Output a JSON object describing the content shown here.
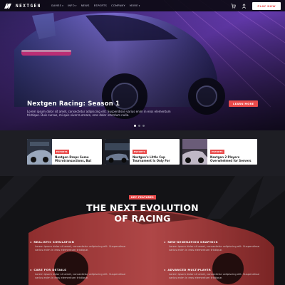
{
  "nav": {
    "logo_icon": "nextgen-logo-icon",
    "wordmark": "NEXTGEN",
    "items": [
      {
        "label": "GAMES",
        "dropdown": true
      },
      {
        "label": "INFO",
        "dropdown": true
      },
      {
        "label": "NEWS",
        "dropdown": false
      },
      {
        "label": "ESPORTS",
        "dropdown": false
      },
      {
        "label": "COMPANY",
        "dropdown": false
      },
      {
        "label": "MORE",
        "dropdown": true
      }
    ],
    "cart_icon": "cart-icon",
    "user_icon": "user-icon",
    "play_label": "PLAY NOW"
  },
  "hero": {
    "title": "Nextgen Racing: Season 1",
    "description": "Lorem ipsum dolor sit amet, consectetur adipiscing elit. Suspendisse varius enim in eros elementum tristique. Duis cursus, mi quis viverra ornare, eros dolor interdum nulla.",
    "cta_label": "LEARN MORE",
    "slides": 3,
    "active_slide": 1
  },
  "news": {
    "cards": [
      {
        "badge": "ESPORTS",
        "title": "Nextgen Drops Some Microtransactions, But"
      },
      {
        "badge": "ESPORTS",
        "title": "Nextgen's Little Cup Tournament Is Only For"
      },
      {
        "badge": "ESPORTS",
        "title": "Nextgen 2 Players Overwhelmed for Servers"
      }
    ]
  },
  "features": {
    "badge": "KEY FEATURES",
    "title_line1": "THE NEXT EVOLUTION",
    "title_line2": "OF RACING",
    "items": [
      {
        "title": "REALISTIC SIMULATION",
        "text": "Lorem ipsum dolor sit amet, consectetur adipiscing elit. Suspendisse varius enim in eros elementum tristique."
      },
      {
        "title": "NEW-GENERATION GRAPHICS",
        "text": "Lorem ipsum dolor sit amet, consectetur adipiscing elit. Suspendisse varius enim in eros elementum tristique."
      },
      {
        "title": "CARE FOR DETAILS",
        "text": "Lorem ipsum dolor sit amet, consectetur adipiscing elit. Suspendisse varius enim in eros elementum tristique."
      },
      {
        "title": "ADVANCED MULTIPLAYER",
        "text": "Lorem ipsum dolor sit amet, consectetur adipiscing elit. Suspendisse varius enim in eros elementum tristique."
      }
    ]
  },
  "colors": {
    "accent": "#e94b4b",
    "nav_bg": "#0c0a12",
    "dark_bg": "#17171b"
  }
}
